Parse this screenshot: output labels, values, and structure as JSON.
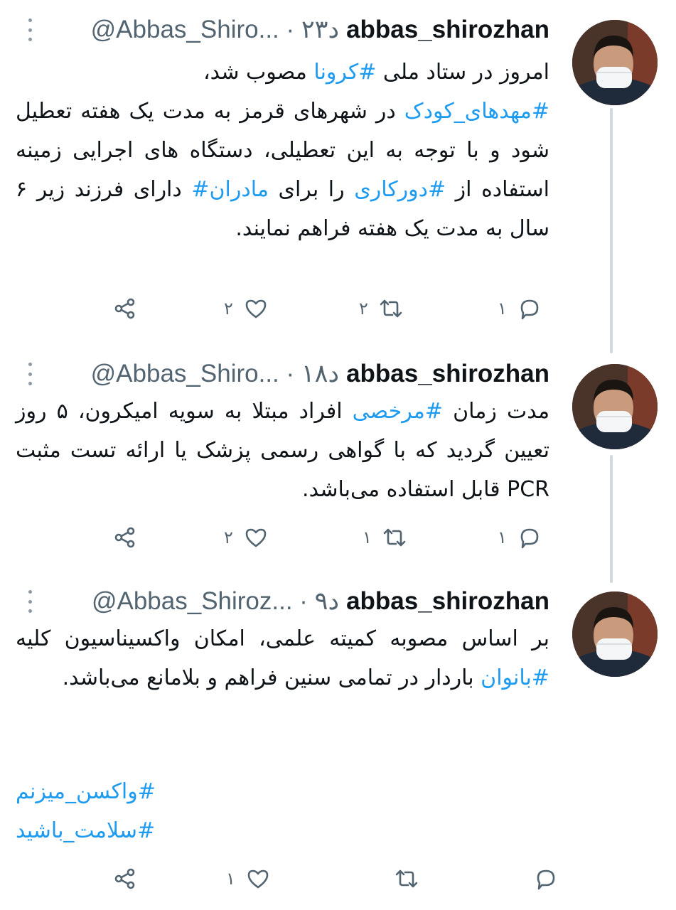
{
  "colors": {
    "text": "#0f1419",
    "secondary": "#536471",
    "link": "#1d9bf0",
    "thread_line": "#cfd9de"
  },
  "tweets": [
    {
      "username": "abbas_shirozhan",
      "handle_time": "@Abbas_Shiro... · ۲۳د",
      "text_before_1": "امروز در ستاد ملی ",
      "tag_1": "#کرونا",
      "text_after_1": " مصوب شد،",
      "tag_2": "#مهدهای_کودک",
      "text_2": " در شهرهای قرمز به مدت یک هفته تعطیل شود و با توجه به این تعطیلی، دستگاه های اجرایی زمینه استفاده از ",
      "tag_3": "#دورکاری",
      "text_3": " را برای ",
      "tag_4": "مادران#",
      "text_4": " دارای فرزند زیر ۶ سال به مدت یک هفته فراهم نمایند.",
      "replies": "۱",
      "retweets": "۲",
      "likes": "۲",
      "icons": [
        "reply-icon",
        "retweet-icon",
        "like-icon",
        "share-icon"
      ]
    },
    {
      "username": "abbas_shirozhan",
      "handle_time": "@Abbas_Shiro... · ۱۸د",
      "text_before_1": "مدت زمان ",
      "tag_1": "#مرخصی",
      "text_after_1": " افراد مبتلا به سویه امیکرون، ۵ روز تعیین گردید که با گواهی رسمی پزشک یا ارائه تست مثبت PCR قابل استفاده می‌باشد.",
      "replies": "۱",
      "retweets": "۱",
      "likes": "۲"
    },
    {
      "username": "abbas_shirozhan",
      "handle_time": "@Abbas_Shiroz... · ۹د",
      "text_before_1": "بر اساس مصوبه کمیته علمی، امکان واکسیناسیون کلیه ",
      "tag_1": "#بانوان",
      "text_after_1": " باردار در تمامی سنین فراهم و بلامانع می‌باشد.",
      "hashtag_line_1": "#واکسن_میزنم",
      "hashtag_line_2": "#سلامت_باشید",
      "replies": "",
      "retweets": "",
      "likes": "۱"
    }
  ]
}
